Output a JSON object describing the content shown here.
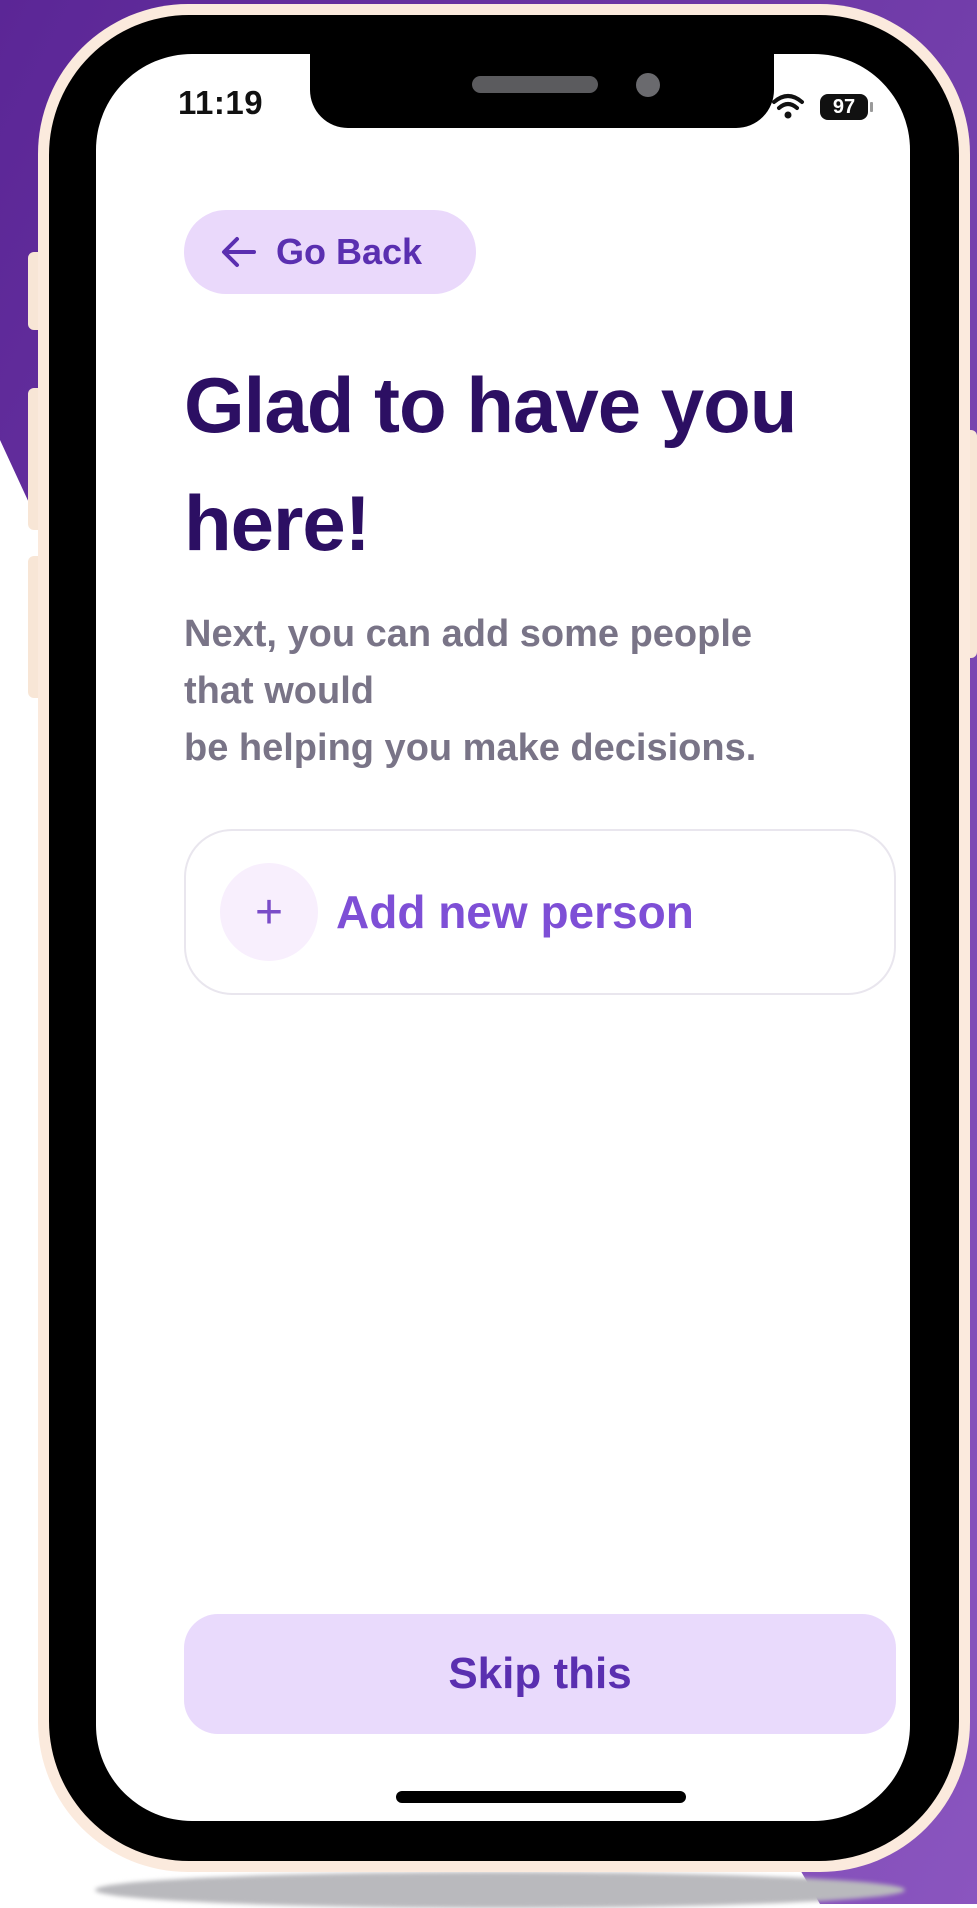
{
  "status_bar": {
    "time": "11:19",
    "battery": "97"
  },
  "icons": {
    "back": "arrow-left-icon",
    "add": "plus-icon",
    "wifi": "wifi-icon",
    "signal": "signal-icon",
    "battery": "battery-icon"
  },
  "header": {
    "back_label": "Go Back",
    "title": "Glad to have you here!",
    "subtitle": "Next, you can add some people\nthat would\n be helping you make decisions."
  },
  "add_person": {
    "plus": "+",
    "label": "Add new person"
  },
  "footer": {
    "skip_label": "Skip this"
  },
  "colors": {
    "accent": "#7e4fd6",
    "accent_light": "#e9dafc",
    "title": "#2c0f63",
    "subtitle": "#797487",
    "background_purple": "#6a2fa5"
  }
}
